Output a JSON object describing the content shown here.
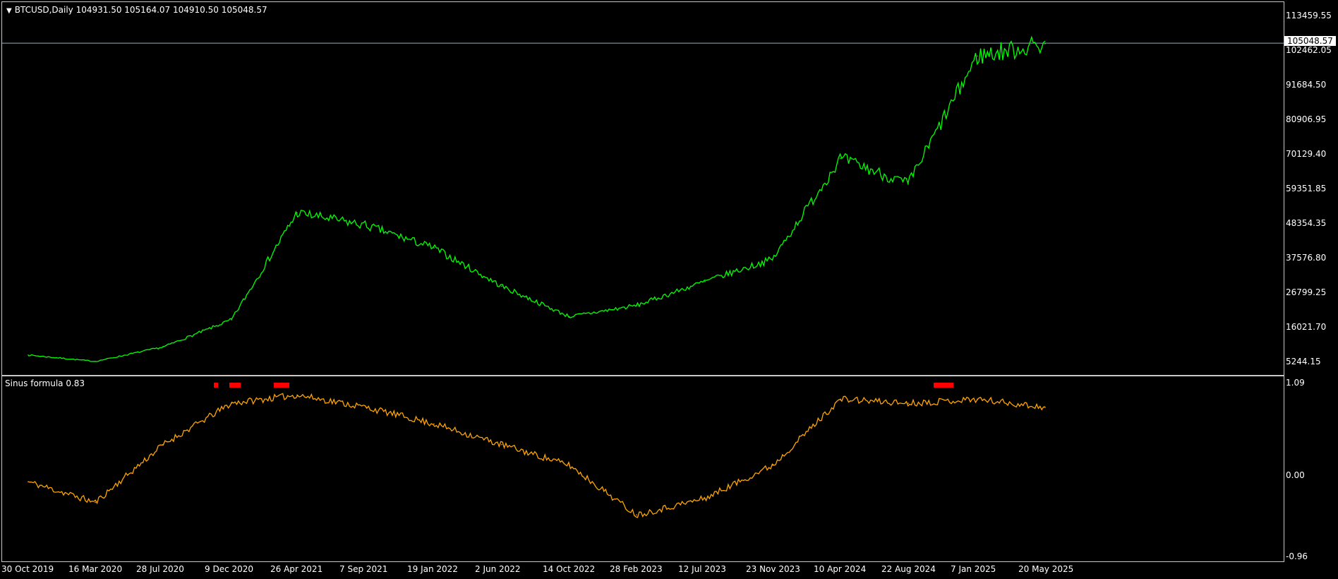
{
  "main": {
    "title": "BTCUSD,Daily  104931.50 105164.07 104910.50 105048.57",
    "current_price_tag": "105048.57",
    "price_axis": [
      "113459.55",
      "102462.05",
      "91684.50",
      "80906.95",
      "70129.40",
      "59351.85",
      "48354.35",
      "37576.80",
      "26799.25",
      "16021.70",
      "5244.15"
    ],
    "line_color": "#00ff00"
  },
  "indicator": {
    "title": "Sinus formula 0.83",
    "axis": [
      "1.09",
      "0.00",
      "-0.96"
    ],
    "line_color": "#ffa500",
    "marker_color": "#ff0000"
  },
  "time_axis": [
    "30 Oct 2019",
    "16 Mar 2020",
    "28 Jul 2020",
    "9 Dec 2020",
    "26 Apr 2021",
    "7 Sep 2021",
    "19 Jan 2022",
    "2 Jun 2022",
    "14 Oct 2022",
    "28 Feb 2023",
    "12 Jul 2023",
    "23 Nov 2023",
    "10 Apr 2024",
    "22 Aug 2024",
    "7 Jan 2025",
    "20 May 2025"
  ],
  "chart_data": [
    {
      "type": "line",
      "title": "BTCUSD,Daily",
      "x": [
        "30 Oct 2019",
        "16 Mar 2020",
        "28 Jul 2020",
        "9 Dec 2020",
        "26 Apr 2021",
        "7 Sep 2021",
        "19 Jan 2022",
        "2 Jun 2022",
        "14 Oct 2022",
        "28 Feb 2023",
        "12 Jul 2023",
        "23 Nov 2023",
        "10 Apr 2024",
        "22 Aug 2024",
        "7 Jan 2025",
        "20 May 2025"
      ],
      "series": [
        {
          "values": [
            7500,
            5500,
            10000,
            18500,
            52000,
            48000,
            41000,
            29000,
            19500,
            23000,
            30500,
            37500,
            69000,
            61000,
            101000,
            104900
          ]
        }
      ],
      "ylim": [
        5244.15,
        113459.55
      ],
      "grid": false
    },
    {
      "type": "line",
      "title": "Sinus formula 0.83",
      "x": [
        "30 Oct 2019",
        "16 Mar 2020",
        "28 Jul 2020",
        "9 Dec 2020",
        "26 Apr 2021",
        "7 Sep 2021",
        "19 Jan 2022",
        "2 Jun 2022",
        "14 Oct 2022",
        "28 Feb 2023",
        "12 Jul 2023",
        "23 Nov 2023",
        "10 Apr 2024",
        "22 Aug 2024",
        "7 Jan 2025",
        "20 May 2025"
      ],
      "series": [
        {
          "values": [
            -0.1,
            -0.35,
            0.35,
            0.85,
            0.95,
            0.8,
            0.6,
            0.35,
            0.1,
            -0.5,
            -0.3,
            0.1,
            0.9,
            0.85,
            0.9,
            0.8
          ]
        }
      ],
      "ylim": [
        -0.96,
        1.09
      ],
      "grid": false
    }
  ]
}
